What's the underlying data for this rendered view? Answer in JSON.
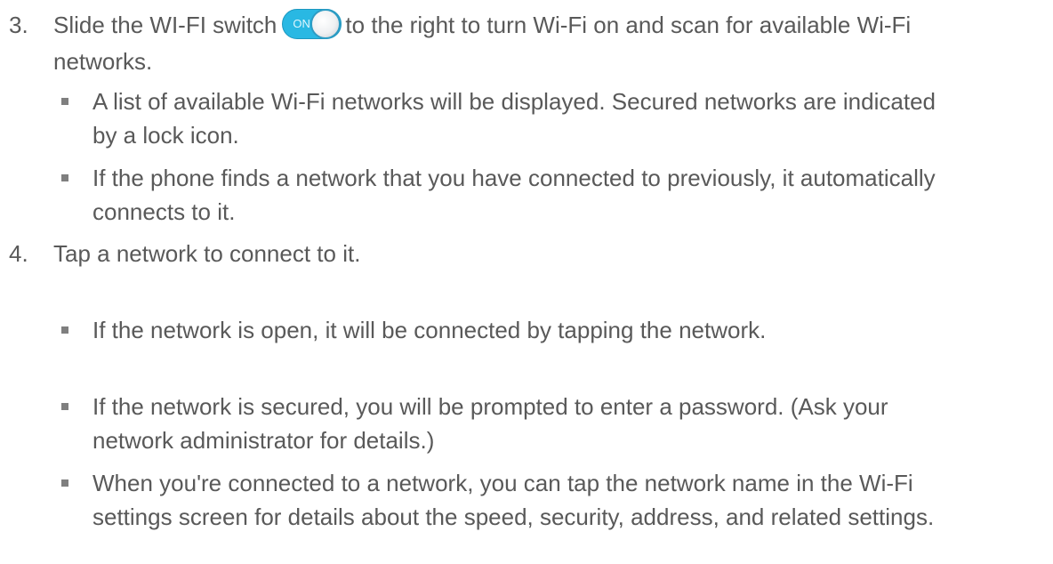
{
  "steps": [
    {
      "number": "3.",
      "lines": [
        {
          "before": "Slide the WI-FI switch",
          "after": "to the right to turn Wi-Fi on and scan for available Wi-Fi"
        },
        {
          "text": "networks."
        }
      ],
      "switch": {
        "label": "ON",
        "state": "on",
        "icon": "toggle-switch-on"
      },
      "bullets": [
        {
          "lines": [
            "A list of available Wi-Fi networks will be displayed. Secured networks are indicated",
            "by a lock icon."
          ]
        },
        {
          "lines": [
            "If the phone finds a network that you have connected to previously, it automatically",
            "connects to it."
          ]
        }
      ]
    },
    {
      "number": "4.",
      "lines": [
        {
          "text": "Tap a network to connect to it."
        }
      ],
      "bullets": [
        {
          "lines": [
            "If the network is open, it will be connected by tapping the network."
          ]
        },
        {
          "lines": [
            "If the network is secured, you will be prompted to enter a password. (Ask your",
            "network administrator for details.)"
          ]
        },
        {
          "lines": [
            "When you're connected to a network, you can tap the network name in the Wi-Fi",
            "settings screen for details about the speed, security, address, and related settings."
          ]
        }
      ]
    }
  ],
  "colors": {
    "text": "#595959",
    "switch_accent": "#29b8e3",
    "bullet": "#7f7f7f"
  }
}
